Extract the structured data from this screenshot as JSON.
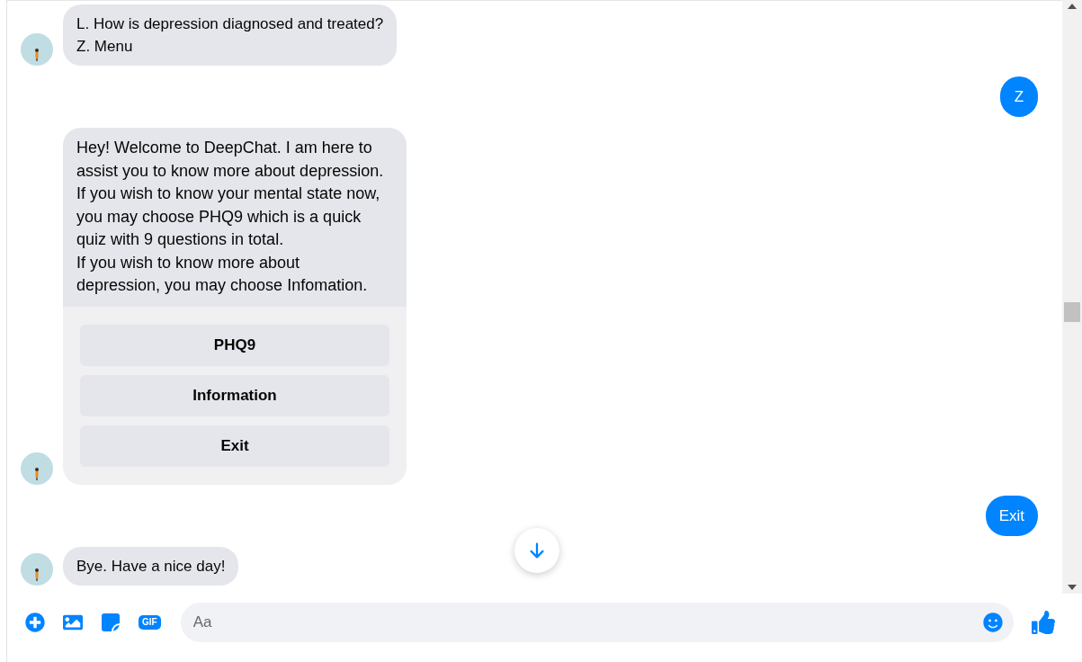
{
  "messages": [
    {
      "kind": "bot",
      "text": "L. How is depression diagnosed and treated?\nZ. Menu"
    },
    {
      "kind": "user",
      "text": "Z"
    },
    {
      "kind": "bot",
      "text": "Hey! Welcome to DeepChat. I am here to assist you to know more about depression.\n If you wish to know your mental state now, you may choose PHQ9 which is a quick quiz with 9 questions in total.\n If you wish to know more about depression, you may choose Infomation.",
      "buttons": [
        "PHQ9",
        "Information",
        "Exit"
      ]
    },
    {
      "kind": "user",
      "text": "Exit"
    },
    {
      "kind": "bot",
      "text": "Bye. Have a nice day!"
    }
  ],
  "composer": {
    "placeholder": "Aa",
    "gif_label": "GIF"
  }
}
